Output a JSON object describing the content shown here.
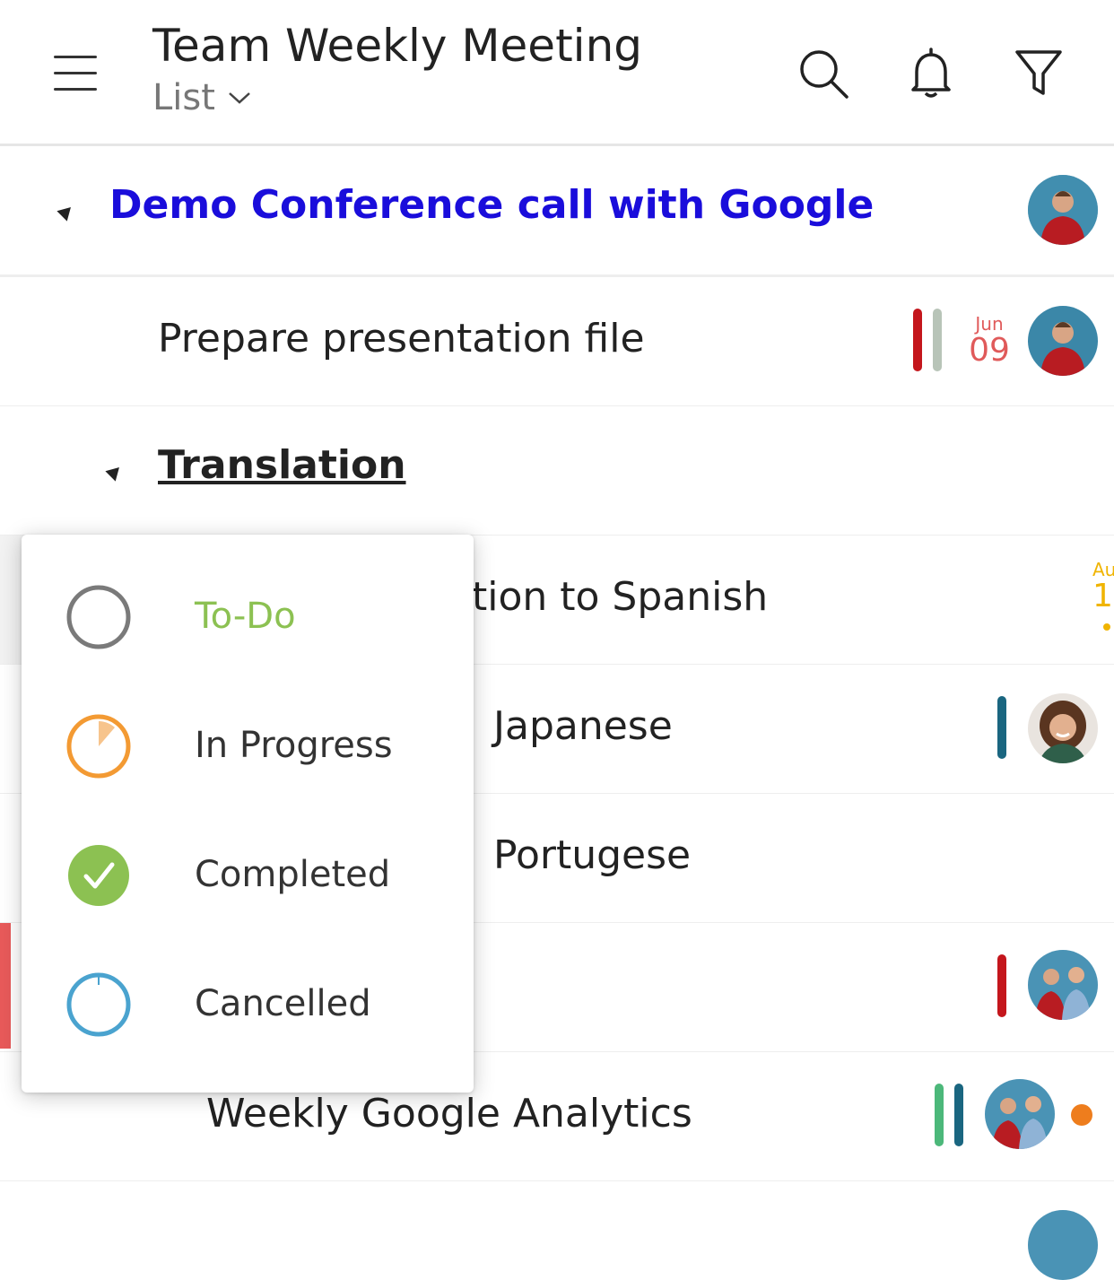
{
  "header": {
    "title": "Team Weekly Meeting",
    "view": "List"
  },
  "rows": {
    "group1": {
      "title": "Demo Conference call with Google"
    },
    "task1": {
      "title": "Prepare presentation file",
      "date_month": "Jun",
      "date_day": "09"
    },
    "group2": {
      "title": "Translation"
    },
    "task2": {
      "title": "tion to Spanish",
      "date_month": "Au",
      "date_day": "1"
    },
    "task3": {
      "title": "Japanese"
    },
    "task4": {
      "title": "Portugese"
    },
    "task6": {
      "title": "Weekly Google Analytics"
    }
  },
  "status_menu": {
    "items": [
      {
        "label": "To-Do",
        "color": "#8cc152"
      },
      {
        "label": "In Progress",
        "color": "#333333"
      },
      {
        "label": "Completed",
        "color": "#333333"
      },
      {
        "label": "Cancelled",
        "color": "#333333"
      }
    ]
  },
  "colors": {
    "group_title": "#1a0ddb",
    "priority_red": "#c4161c",
    "priority_gray": "#b8c4b8",
    "priority_teal": "#1a6680",
    "priority_green": "#4cb87a",
    "date_red": "#e05a5a",
    "date_yellow": "#f0b400",
    "orange": "#ee7d1d"
  }
}
